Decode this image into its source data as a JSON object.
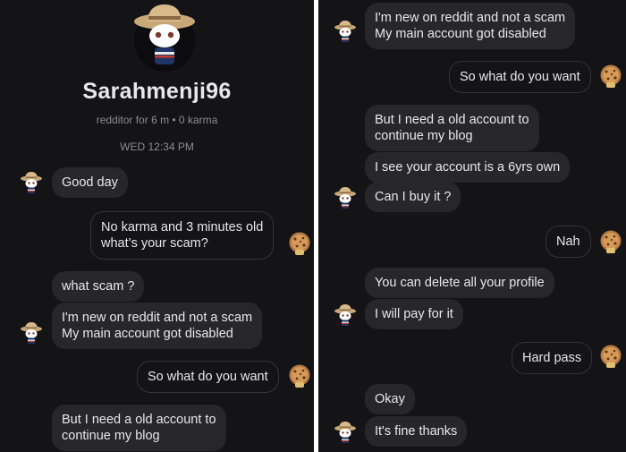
{
  "profile": {
    "username": "Sarahmenji96",
    "meta": "redditor for 6 m • 0 karma",
    "timestamp": "WED 12:34 PM"
  },
  "left_messages": [
    {
      "id": "l1",
      "sender": "them",
      "text": "Good day"
    },
    {
      "id": "l2",
      "sender": "me",
      "text": "No karma and 3 minutes old\nwhat’s your scam?"
    },
    {
      "id": "l3",
      "sender": "them",
      "text": "what scam ?"
    },
    {
      "id": "l4",
      "sender": "them",
      "text": "I'm new on reddit and not a scam\nMy main account got disabled"
    },
    {
      "id": "l5",
      "sender": "me",
      "text": "So what do you want"
    },
    {
      "id": "l6",
      "sender": "them",
      "text": "But I need a old account to\ncontinue my blog"
    }
  ],
  "right_messages": [
    {
      "id": "r1",
      "sender": "them",
      "text": "I'm new on reddit and not a scam\nMy main account got disabled"
    },
    {
      "id": "r2",
      "sender": "me",
      "text": "So what do you want"
    },
    {
      "id": "r3",
      "sender": "them",
      "text": "But I need a old account to\ncontinue my blog"
    },
    {
      "id": "r4",
      "sender": "them",
      "text": "I see your account is a 6yrs own"
    },
    {
      "id": "r5",
      "sender": "them",
      "text": "Can I buy it ?"
    },
    {
      "id": "r6",
      "sender": "me",
      "text": "Nah"
    },
    {
      "id": "r7",
      "sender": "them",
      "text": "You can delete all your profile"
    },
    {
      "id": "r8",
      "sender": "them",
      "text": "I will pay for it"
    },
    {
      "id": "r9",
      "sender": "me",
      "text": "Hard pass"
    },
    {
      "id": "r10",
      "sender": "them",
      "text": "Okay"
    },
    {
      "id": "r11",
      "sender": "them",
      "text": "It's fine thanks"
    }
  ],
  "avatars": {
    "them": "cowboy-hat-snoo-avatar-icon",
    "me": "cookie-snoo-avatar-icon"
  },
  "colors": {
    "background": "#141416",
    "bubble_them": "#27272a",
    "bubble_me_border": "#343438",
    "text": "#e8e8ea",
    "muted_text": "#8c8c92"
  }
}
